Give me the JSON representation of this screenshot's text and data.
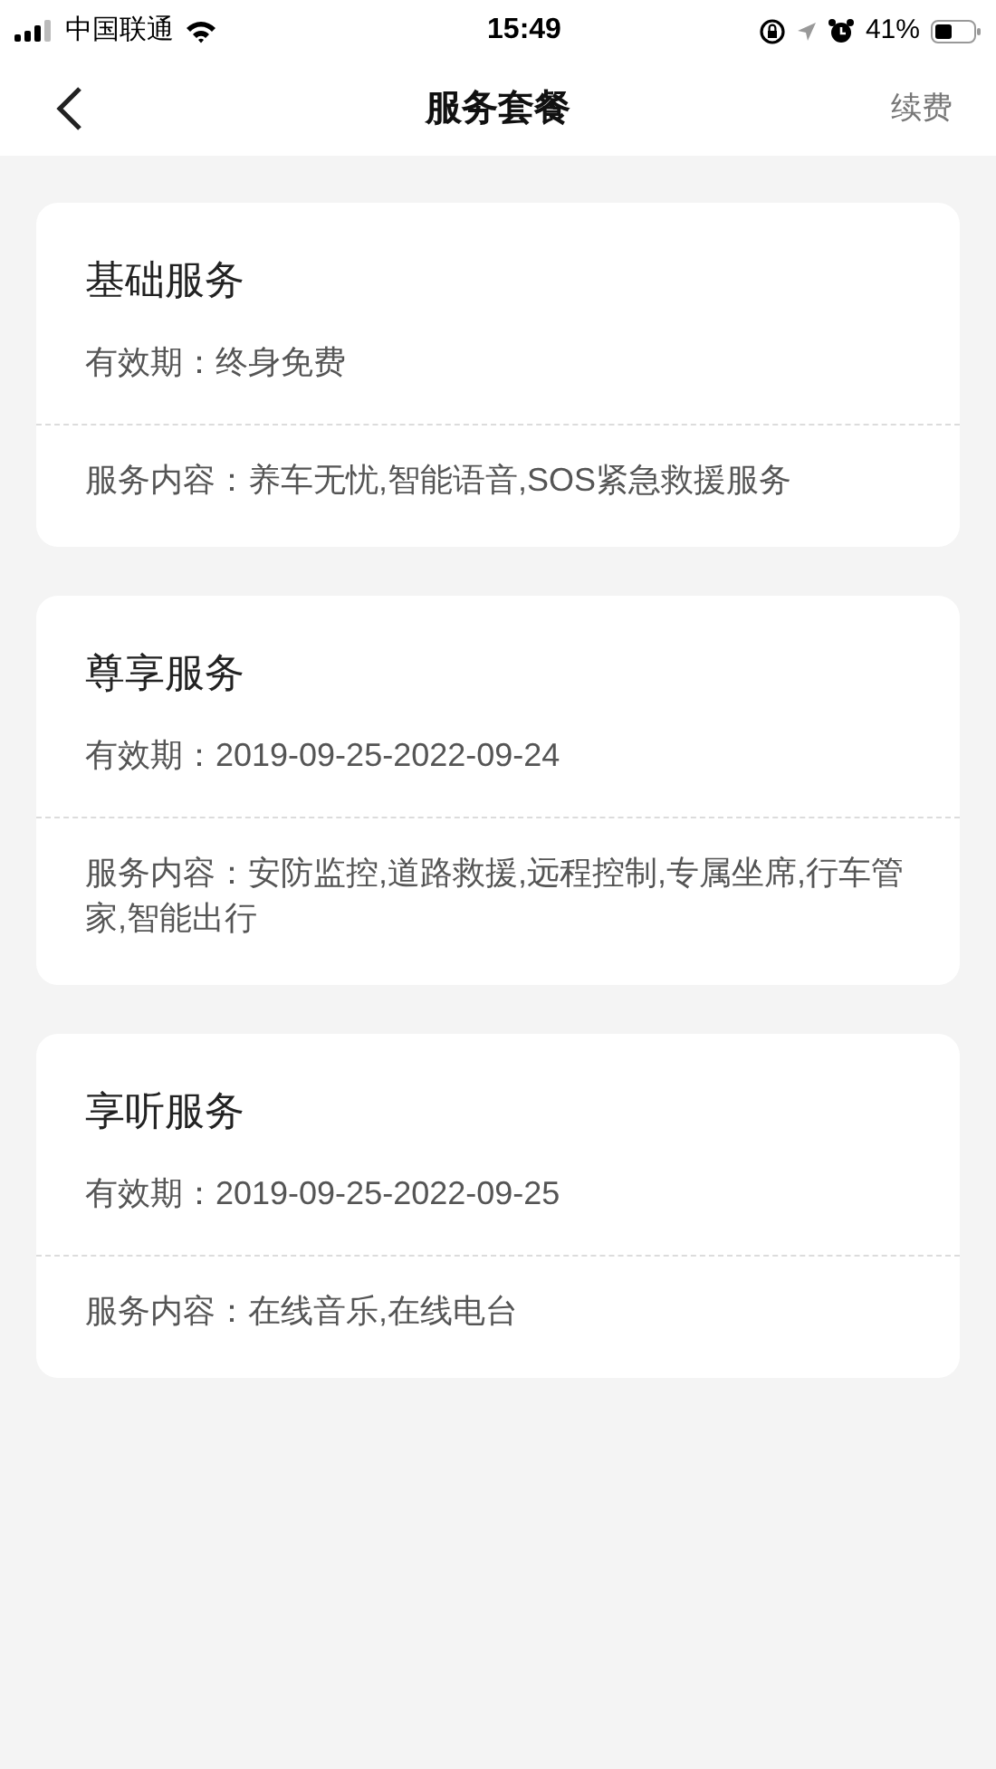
{
  "status_bar": {
    "carrier": "中国联通",
    "time": "15:49",
    "battery": "41%"
  },
  "nav": {
    "title": "服务套餐",
    "action": "续费"
  },
  "cards": [
    {
      "title": "基础服务",
      "validity": "有效期：终身免费",
      "content": "服务内容：养车无忧,智能语音,SOS紧急救援服务"
    },
    {
      "title": "尊享服务",
      "validity": "有效期：2019-09-25-2022-09-24",
      "content": "服务内容：安防监控,道路救援,远程控制,专属坐席,行车管家,智能出行"
    },
    {
      "title": "享听服务",
      "validity": "有效期：2019-09-25-2022-09-25",
      "content": "服务内容：在线音乐,在线电台"
    }
  ]
}
